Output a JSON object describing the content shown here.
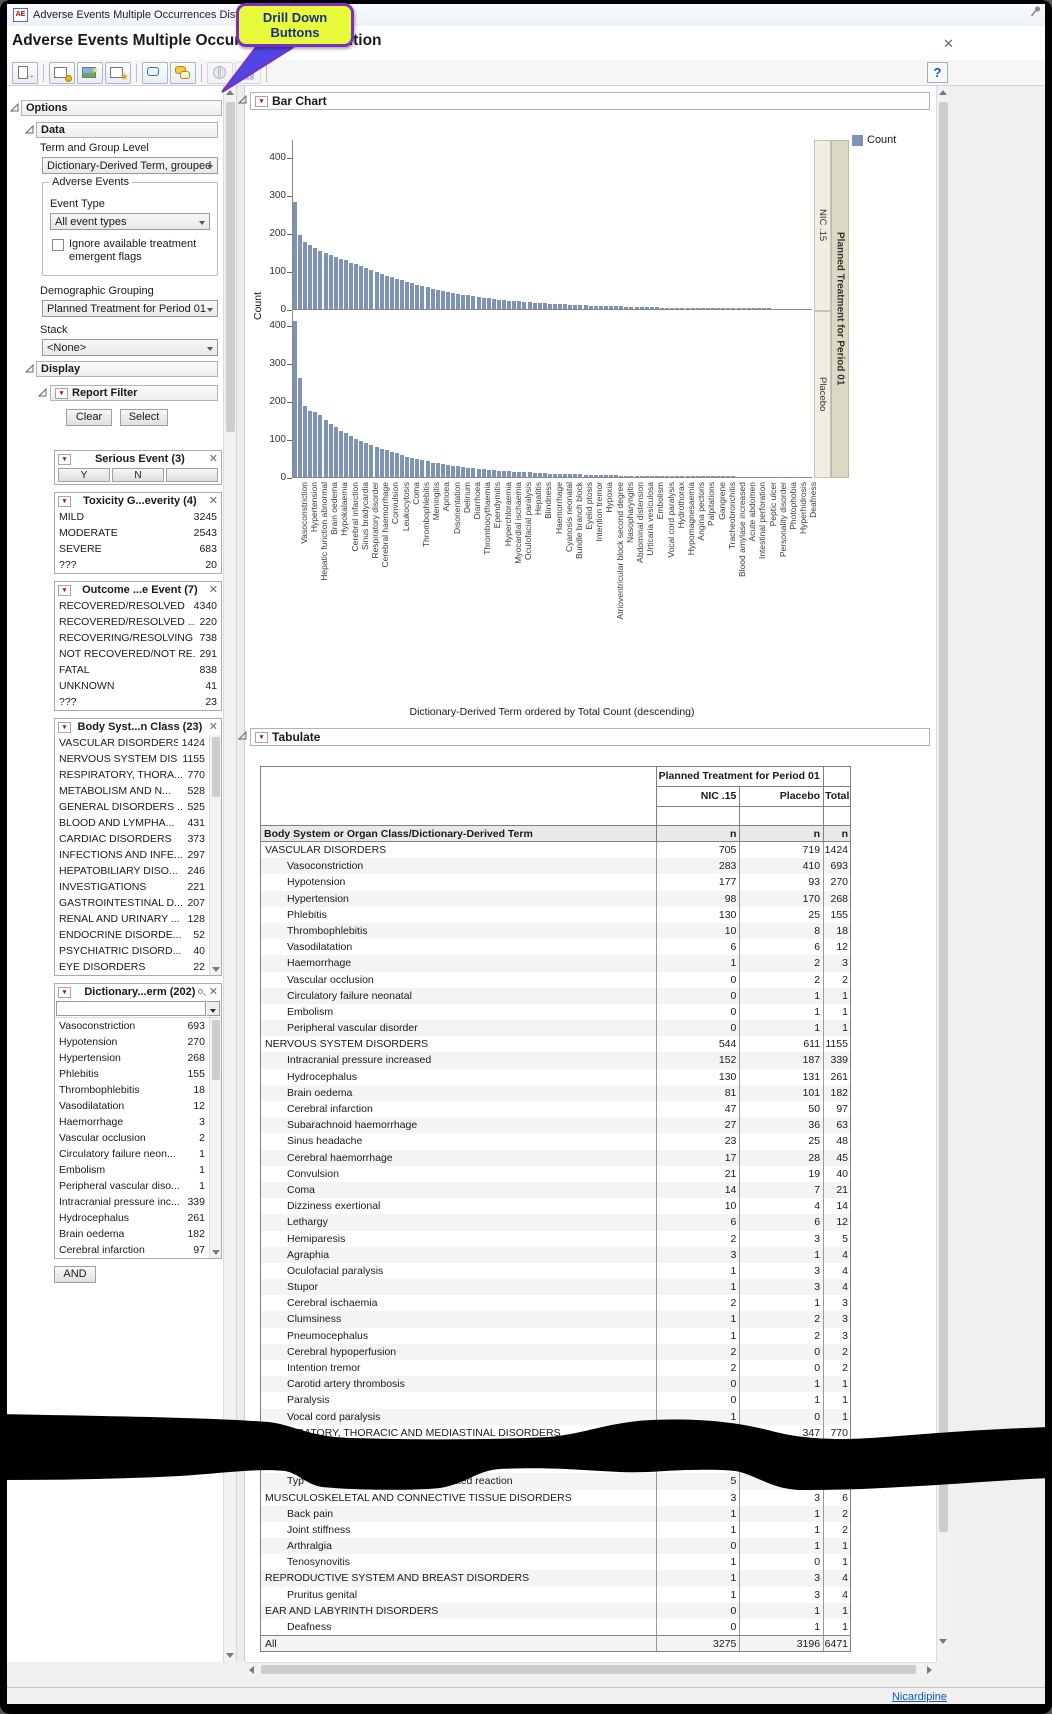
{
  "window": {
    "title": "Adverse Events Multiple Occurrences Distribu",
    "heading": "Adverse Events Multiple Occurrences Distribution",
    "help_label": "?",
    "status_link": "Nicardipine"
  },
  "callout": {
    "line1": "Drill Down",
    "line2": "Buttons"
  },
  "toolbar": {
    "groups": [
      [
        {
          "name": "export-report-button",
          "icon": "export",
          "disabled": false
        }
      ],
      [
        {
          "name": "data-table-button",
          "icon": "table-clock",
          "disabled": false
        },
        {
          "name": "image-button",
          "icon": "picture",
          "disabled": false
        },
        {
          "name": "new-data-view-button",
          "icon": "table-star",
          "disabled": false
        }
      ],
      [
        {
          "name": "add-note-button",
          "icon": "bubble",
          "disabled": false
        },
        {
          "name": "show-notes-button",
          "icon": "bubbles",
          "disabled": false
        }
      ],
      [
        {
          "name": "drill-down-globe-button",
          "icon": "globe",
          "disabled": true
        },
        {
          "name": "drill-down-chart-button",
          "icon": "chart",
          "disabled": true
        }
      ]
    ]
  },
  "sidebar": {
    "options_label": "Options",
    "data": {
      "label": "Data",
      "term_group_label": "Term and Group Level",
      "term_group_value": "Dictionary-Derived Term, grouped",
      "adverse_events_label": "Adverse Events",
      "event_type_label": "Event Type",
      "event_type_value": "All event types",
      "ignore_flags_label": "Ignore available treatment emergent flags",
      "demographic_label": "Demographic Grouping",
      "demographic_value": "Planned Treatment for Period 01",
      "stack_label": "Stack",
      "stack_value": "<None>"
    },
    "display": {
      "label": "Display",
      "report_filter_label": "Report Filter",
      "clear_label": "Clear",
      "select_label": "Select",
      "and_label": "AND",
      "filters": [
        {
          "title": "Serious Event (3)",
          "buttons": [
            "Y",
            "N",
            ""
          ]
        },
        {
          "title": "Toxicity G...everity (4)",
          "rows": [
            [
              "MILD",
              "3245"
            ],
            [
              "MODERATE",
              "2543"
            ],
            [
              "SEVERE",
              "683"
            ],
            [
              "???",
              "20"
            ]
          ]
        },
        {
          "title": "Outcome ...e Event (7)",
          "rows": [
            [
              "RECOVERED/RESOLVED",
              "4340"
            ],
            [
              "RECOVERED/RESOLVED ...",
              "220"
            ],
            [
              "RECOVERING/RESOLVING",
              "738"
            ],
            [
              "NOT RECOVERED/NOT RE...",
              "291"
            ],
            [
              "FATAL",
              "838"
            ],
            [
              "UNKNOWN",
              "41"
            ],
            [
              "???",
              "23"
            ]
          ]
        },
        {
          "title": "Body Syst...n Class (23)",
          "scroll": true,
          "rows": [
            [
              "VASCULAR DISORDERS",
              "1424"
            ],
            [
              "NERVOUS SYSTEM DIS...",
              "1155"
            ],
            [
              "RESPIRATORY, THORA...",
              "770"
            ],
            [
              "METABOLISM AND N...",
              "528"
            ],
            [
              "GENERAL DISORDERS ...",
              "525"
            ],
            [
              "BLOOD AND LYMPHA...",
              "431"
            ],
            [
              "CARDIAC DISORDERS",
              "373"
            ],
            [
              "INFECTIONS AND INFE...",
              "297"
            ],
            [
              "HEPATOBILIARY DISO...",
              "246"
            ],
            [
              "INVESTIGATIONS",
              "221"
            ],
            [
              "GASTROINTESTINAL D...",
              "207"
            ],
            [
              "RENAL AND URINARY ...",
              "128"
            ],
            [
              "ENDOCRINE DISORDE...",
              "52"
            ],
            [
              "PSYCHIATRIC DISORD...",
              "40"
            ],
            [
              "EYE DISORDERS",
              "22"
            ]
          ]
        },
        {
          "title": "Dictionary...erm (202)",
          "search": true,
          "scroll": true,
          "rows": [
            [
              "Vasoconstriction",
              "693"
            ],
            [
              "Hypotension",
              "270"
            ],
            [
              "Hypertension",
              "268"
            ],
            [
              "Phlebitis",
              "155"
            ],
            [
              "Thrombophlebitis",
              "18"
            ],
            [
              "Vasodilatation",
              "12"
            ],
            [
              "Haemorrhage",
              "3"
            ],
            [
              "Vascular occlusion",
              "2"
            ],
            [
              "Circulatory failure neon...",
              "1"
            ],
            [
              "Embolism",
              "1"
            ],
            [
              "Peripheral vascular diso...",
              "1"
            ],
            [
              "Intracranial pressure inc...",
              "339"
            ],
            [
              "Hydrocephalus",
              "261"
            ],
            [
              "Brain oedema",
              "182"
            ],
            [
              "Cerebral infarction",
              "97"
            ]
          ]
        }
      ]
    }
  },
  "bar_chart": {
    "type": "bar",
    "title": "Bar Chart",
    "legend_label": "Count",
    "y_label": "Count",
    "y_ticks": [
      400,
      300,
      200,
      100,
      0
    ],
    "ylim": [
      0,
      430
    ],
    "bar_color": "#7e93b8",
    "group_label": "Planned Treatment for Period 01",
    "caption": "Dictionary-Derived Term ordered by Total Count (descending)",
    "panels": [
      {
        "label": "NIC .15",
        "values": [
          283,
          195,
          177,
          168,
          160,
          152,
          148,
          143,
          138,
          132,
          128,
          122,
          118,
          112,
          108,
          102,
          98,
          92,
          88,
          84,
          80,
          76,
          72,
          68,
          64,
          60,
          57,
          54,
          51,
          48,
          45,
          42,
          40,
          38,
          36,
          34,
          32,
          30,
          28,
          26,
          25,
          23,
          22,
          21,
          20,
          19,
          18,
          17,
          16,
          15,
          14,
          13,
          13,
          12,
          11,
          11,
          10,
          10,
          9,
          9,
          8,
          8,
          7,
          7,
          7,
          6,
          6,
          6,
          5,
          5,
          5,
          5,
          4,
          4,
          4,
          4,
          4,
          3,
          3,
          3,
          3,
          3,
          3,
          3,
          2,
          2,
          2,
          2,
          2,
          2,
          2,
          2,
          2,
          2,
          1,
          1,
          1,
          1,
          1,
          1,
          1,
          1
        ]
      },
      {
        "label": "Placebo",
        "values": [
          410,
          260,
          187,
          175,
          170,
          162,
          150,
          140,
          131,
          122,
          115,
          108,
          101,
          95,
          90,
          85,
          80,
          75,
          70,
          66,
          62,
          58,
          54,
          50,
          47,
          44,
          41,
          38,
          36,
          34,
          32,
          30,
          28,
          26,
          24,
          23,
          21,
          20,
          19,
          18,
          17,
          16,
          15,
          14,
          13,
          12,
          12,
          11,
          10,
          10,
          9,
          9,
          8,
          8,
          7,
          7,
          7,
          6,
          6,
          6,
          5,
          5,
          5,
          5,
          4,
          4,
          4,
          4,
          4,
          3,
          3,
          3,
          3,
          3,
          3,
          3,
          2,
          2,
          2,
          2,
          2,
          2,
          2,
          2,
          2,
          2,
          2,
          1,
          1,
          1,
          1,
          1,
          1,
          1,
          1,
          1,
          1,
          1,
          1,
          1,
          1,
          1
        ]
      }
    ],
    "x_tick_labels": [
      "Vasoconstriction",
      "Hypertension",
      "Hepatic function abnormal",
      "Brain oedema",
      "Hypokalaemia",
      "Cerebral infarction",
      "Sinus bradycardia",
      "Respiratory disorder",
      "Cerebral haemorrhage",
      "Convulsion",
      "Leukocytosis",
      "Coma",
      "Thrombophlebitis",
      "Meningitis",
      "Apnoea",
      "Disorientation",
      "Delirium",
      "Diarrhoea",
      "Thrombocythaemia",
      "Ependymitis",
      "Hyperchloraemia",
      "Myocardial ischaemia",
      "Oculofacial paralysis",
      "Hepatitis",
      "Blindness",
      "Haemorrhage",
      "Cyanosis neonatal",
      "Bundle branch block",
      "Eyelid ptosis",
      "Intention tremor",
      "Hypoxia",
      "Atrioventricular block second degree",
      "Nasopharyngitis",
      "Abdominal distension",
      "Urticaria vesiculosa",
      "Embolism",
      "Vocal cord paralysis",
      "Hydrothorax",
      "Hypomagnesaemia",
      "Angina pectoris",
      "Palpitations",
      "Gangrene",
      "Tracheobronchitis",
      "Blood amylase increased",
      "Acute abdomen",
      "Intestinal perforation",
      "Peptic ulcer",
      "Personality disorder",
      "Photophobia",
      "Hyperhidrosis",
      "Deafness"
    ]
  },
  "tabulate": {
    "title": "Tabulate",
    "col_group": "Planned Treatment for Period 01",
    "columns": [
      "NIC .15",
      "Placebo",
      "Total"
    ],
    "row_header": "Body System or Organ Class/Dictionary-Derived Term",
    "n_label": "n",
    "rows": [
      {
        "i": 0,
        "t": "VASCULAR DISORDERS",
        "n": "705",
        "p": "719",
        "tot": "1424"
      },
      {
        "i": 1,
        "t": "Vasoconstriction",
        "n": "283",
        "p": "410",
        "tot": "693"
      },
      {
        "i": 1,
        "t": "Hypotension",
        "n": "177",
        "p": "93",
        "tot": "270"
      },
      {
        "i": 1,
        "t": "Hypertension",
        "n": "98",
        "p": "170",
        "tot": "268"
      },
      {
        "i": 1,
        "t": "Phlebitis",
        "n": "130",
        "p": "25",
        "tot": "155"
      },
      {
        "i": 1,
        "t": "Thrombophlebitis",
        "n": "10",
        "p": "8",
        "tot": "18"
      },
      {
        "i": 1,
        "t": "Vasodilatation",
        "n": "6",
        "p": "6",
        "tot": "12"
      },
      {
        "i": 1,
        "t": "Haemorrhage",
        "n": "1",
        "p": "2",
        "tot": "3"
      },
      {
        "i": 1,
        "t": "Vascular occlusion",
        "n": "0",
        "p": "2",
        "tot": "2"
      },
      {
        "i": 1,
        "t": "Circulatory failure neonatal",
        "n": "0",
        "p": "1",
        "tot": "1"
      },
      {
        "i": 1,
        "t": "Embolism",
        "n": "0",
        "p": "1",
        "tot": "1"
      },
      {
        "i": 1,
        "t": "Peripheral vascular disorder",
        "n": "0",
        "p": "1",
        "tot": "1"
      },
      {
        "i": 0,
        "t": "NERVOUS SYSTEM DISORDERS",
        "n": "544",
        "p": "611",
        "tot": "1155"
      },
      {
        "i": 1,
        "t": "Intracranial pressure increased",
        "n": "152",
        "p": "187",
        "tot": "339"
      },
      {
        "i": 1,
        "t": "Hydrocephalus",
        "n": "130",
        "p": "131",
        "tot": "261"
      },
      {
        "i": 1,
        "t": "Brain oedema",
        "n": "81",
        "p": "101",
        "tot": "182"
      },
      {
        "i": 1,
        "t": "Cerebral infarction",
        "n": "47",
        "p": "50",
        "tot": "97"
      },
      {
        "i": 1,
        "t": "Subarachnoid haemorrhage",
        "n": "27",
        "p": "36",
        "tot": "63"
      },
      {
        "i": 1,
        "t": "Sinus headache",
        "n": "23",
        "p": "25",
        "tot": "48"
      },
      {
        "i": 1,
        "t": "Cerebral haemorrhage",
        "n": "17",
        "p": "28",
        "tot": "45"
      },
      {
        "i": 1,
        "t": "Convulsion",
        "n": "21",
        "p": "19",
        "tot": "40"
      },
      {
        "i": 1,
        "t": "Coma",
        "n": "14",
        "p": "7",
        "tot": "21"
      },
      {
        "i": 1,
        "t": "Dizziness exertional",
        "n": "10",
        "p": "4",
        "tot": "14"
      },
      {
        "i": 1,
        "t": "Lethargy",
        "n": "6",
        "p": "6",
        "tot": "12"
      },
      {
        "i": 1,
        "t": "Hemiparesis",
        "n": "2",
        "p": "3",
        "tot": "5"
      },
      {
        "i": 1,
        "t": "Agraphia",
        "n": "3",
        "p": "1",
        "tot": "4"
      },
      {
        "i": 1,
        "t": "Oculofacial paralysis",
        "n": "1",
        "p": "3",
        "tot": "4"
      },
      {
        "i": 1,
        "t": "Stupor",
        "n": "1",
        "p": "3",
        "tot": "4"
      },
      {
        "i": 1,
        "t": "Cerebral ischaemia",
        "n": "2",
        "p": "1",
        "tot": "3"
      },
      {
        "i": 1,
        "t": "Clumsiness",
        "n": "1",
        "p": "2",
        "tot": "3"
      },
      {
        "i": 1,
        "t": "Pneumocephalus",
        "n": "1",
        "p": "2",
        "tot": "3"
      },
      {
        "i": 1,
        "t": "Cerebral hypoperfusion",
        "n": "2",
        "p": "0",
        "tot": "2"
      },
      {
        "i": 1,
        "t": "Intention tremor",
        "n": "2",
        "p": "0",
        "tot": "2"
      },
      {
        "i": 1,
        "t": "Carotid artery thrombosis",
        "n": "0",
        "p": "1",
        "tot": "1"
      },
      {
        "i": 1,
        "t": "Paralysis",
        "n": "0",
        "p": "1",
        "tot": "1"
      },
      {
        "i": 1,
        "t": "Vocal cord paralysis",
        "n": "1",
        "p": "0",
        "tot": "1"
      },
      {
        "i": 0,
        "t": "RESPIRATORY, THORACIC AND MEDIASTINAL DISORDERS",
        "n": "",
        "p": "347",
        "tot": "770"
      },
      {
        "i": 0,
        "t": "",
        "n": "",
        "p": "",
        "tot": ""
      },
      {
        "i": 0,
        "t": "",
        "n": "",
        "p": "",
        "tot": ""
      },
      {
        "i": 1,
        "t": "Typ",
        "t2": "ated reaction",
        "n": "5",
        "p": "",
        "tot": ""
      },
      {
        "i": 0,
        "t": "MUSCULOSKELETAL AND CONNECTIVE TISSUE DISORDERS",
        "n": "3",
        "p": "3",
        "tot": "6"
      },
      {
        "i": 1,
        "t": "Back pain",
        "n": "1",
        "p": "1",
        "tot": "2"
      },
      {
        "i": 1,
        "t": "Joint stiffness",
        "n": "1",
        "p": "1",
        "tot": "2"
      },
      {
        "i": 1,
        "t": "Arthralgia",
        "n": "0",
        "p": "1",
        "tot": "1"
      },
      {
        "i": 1,
        "t": "Tenosynovitis",
        "n": "1",
        "p": "0",
        "tot": "1"
      },
      {
        "i": 0,
        "t": "REPRODUCTIVE SYSTEM AND BREAST DISORDERS",
        "n": "1",
        "p": "3",
        "tot": "4"
      },
      {
        "i": 1,
        "t": "Pruritus genital",
        "n": "1",
        "p": "3",
        "tot": "4"
      },
      {
        "i": 0,
        "t": "EAR AND LABYRINTH DISORDERS",
        "n": "0",
        "p": "1",
        "tot": "1"
      },
      {
        "i": 1,
        "t": "Deafness",
        "n": "0",
        "p": "1",
        "tot": "1"
      },
      {
        "i": 0,
        "t": "All",
        "n": "3275",
        "p": "3196",
        "tot": "6471"
      }
    ]
  }
}
